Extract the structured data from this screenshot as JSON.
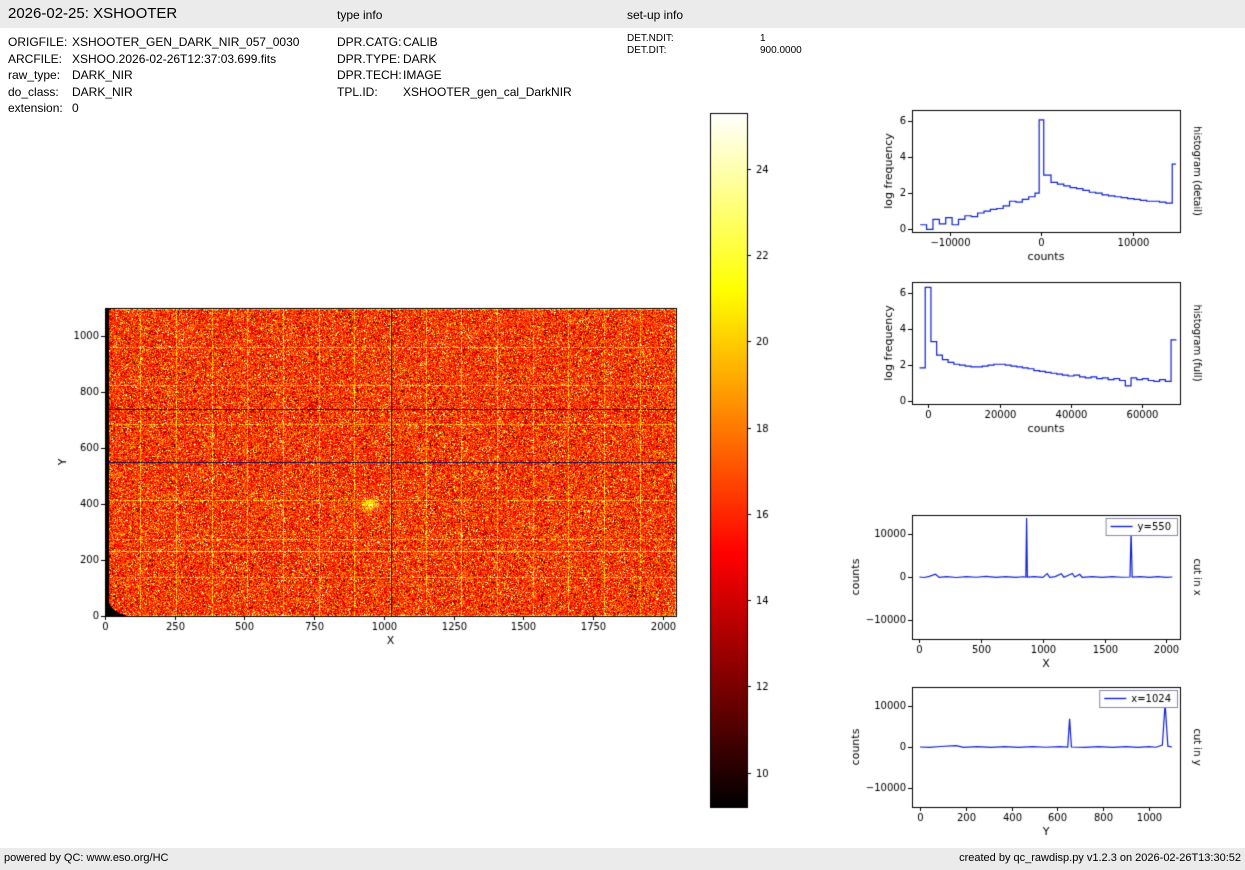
{
  "header": {
    "title": "2026-02-25: XSHOOTER",
    "type_info_label": "type info",
    "setup_info_label": "set-up info",
    "file_info": [
      {
        "label": "ORIGFILE:",
        "value": "XSHOOTER_GEN_DARK_NIR_057_0030"
      },
      {
        "label": "ARCFILE:",
        "value": "XSHOO.2026-02-26T12:37:03.699.fits"
      },
      {
        "label": "raw_type:",
        "value": "DARK_NIR"
      },
      {
        "label": "do_class:",
        "value": "DARK_NIR"
      },
      {
        "label": "extension:",
        "value": "0"
      }
    ],
    "type_info": [
      {
        "label": "DPR.CATG:",
        "value": "CALIB"
      },
      {
        "label": "DPR.TYPE:",
        "value": "DARK"
      },
      {
        "label": "DPR.TECH:",
        "value": "IMAGE"
      },
      {
        "label": "TPL.ID:",
        "value": "XSHOOTER_gen_cal_DarkNIR"
      }
    ],
    "setup_info": [
      {
        "label": "DET.NDIT:",
        "value": "1"
      },
      {
        "label": "DET.DIT:",
        "value": "900.0000"
      }
    ]
  },
  "footer": {
    "left": "powered by QC: www.eso.org/HC",
    "right": "created by qc_rawdisp.py v1.2.3 on 2026-02-26T13:30:52"
  },
  "chart_data": [
    {
      "id": "raw_image",
      "type": "heatmap",
      "description": "Raw NIR dark frame displayed with hot colormap: orange/red noise, scattered bright and dark speckles, faint bright grid lines, black left edge and rounded dark corners, dark crosshair cut lines at x=1024 and y=550",
      "xlabel": "X",
      "ylabel": "Y",
      "xlim": [
        0,
        2048
      ],
      "ylim": [
        0,
        1100
      ],
      "xticks": [
        0,
        250,
        500,
        750,
        1000,
        1250,
        1500,
        1750,
        2000
      ],
      "yticks": [
        0,
        200,
        400,
        600,
        800,
        1000
      ],
      "colormap": "hot",
      "value_range": [
        9.2,
        25.3
      ],
      "colorbar_ticks": [
        10,
        12,
        14,
        16,
        18,
        20,
        22,
        24
      ],
      "crosshair": {
        "x": 1024,
        "y": 550
      }
    },
    {
      "id": "histogram_detail",
      "type": "line",
      "step": true,
      "color": "#1122cc",
      "xlabel": "counts",
      "ylabel": "log frequency",
      "right_label": "histogram (detail)",
      "xlim": [
        -14200,
        15200
      ],
      "ylim": [
        -0.15,
        6.6
      ],
      "xticks": [
        -10000,
        0,
        10000
      ],
      "yticks": [
        0,
        2,
        4,
        6
      ],
      "points": [
        [
          -13300,
          0.25
        ],
        [
          -12600,
          0
        ],
        [
          -11900,
          0.55
        ],
        [
          -11200,
          0.3
        ],
        [
          -10500,
          0.65
        ],
        [
          -9800,
          0.25
        ],
        [
          -9100,
          0.55
        ],
        [
          -8400,
          0.75
        ],
        [
          -7700,
          0.7
        ],
        [
          -7000,
          0.9
        ],
        [
          -6300,
          1.0
        ],
        [
          -5600,
          1.1
        ],
        [
          -4900,
          1.15
        ],
        [
          -4200,
          1.3
        ],
        [
          -3500,
          1.55
        ],
        [
          -2800,
          1.5
        ],
        [
          -2100,
          1.65
        ],
        [
          -1400,
          1.8
        ],
        [
          -700,
          2.0
        ],
        [
          -250,
          6.05
        ],
        [
          250,
          3.0
        ],
        [
          1050,
          2.6
        ],
        [
          1750,
          2.5
        ],
        [
          2450,
          2.4
        ],
        [
          3150,
          2.3
        ],
        [
          3850,
          2.25
        ],
        [
          4550,
          2.15
        ],
        [
          5250,
          2.05
        ],
        [
          5950,
          2.0
        ],
        [
          6650,
          1.9
        ],
        [
          7350,
          1.85
        ],
        [
          8050,
          1.8
        ],
        [
          8750,
          1.75
        ],
        [
          9450,
          1.7
        ],
        [
          10150,
          1.65
        ],
        [
          10850,
          1.6
        ],
        [
          11550,
          1.55
        ],
        [
          12250,
          1.55
        ],
        [
          12950,
          1.5
        ],
        [
          13650,
          1.45
        ],
        [
          14350,
          3.6
        ],
        [
          14750,
          3.6
        ]
      ]
    },
    {
      "id": "histogram_full",
      "type": "line",
      "step": true,
      "color": "#1122cc",
      "xlabel": "counts",
      "ylabel": "log frequency",
      "right_label": "histogram (full)",
      "xlim": [
        -4500,
        70500
      ],
      "ylim": [
        -0.15,
        6.6
      ],
      "xticks": [
        0,
        20000,
        40000,
        60000
      ],
      "yticks": [
        0,
        2,
        4,
        6
      ],
      "points": [
        [
          -2400,
          1.85
        ],
        [
          -800,
          6.3
        ],
        [
          800,
          3.3
        ],
        [
          2400,
          2.55
        ],
        [
          4000,
          2.3
        ],
        [
          5600,
          2.15
        ],
        [
          7200,
          2.05
        ],
        [
          8800,
          2.0
        ],
        [
          10400,
          1.95
        ],
        [
          12000,
          1.9
        ],
        [
          13600,
          1.9
        ],
        [
          15200,
          1.95
        ],
        [
          16800,
          2.0
        ],
        [
          18400,
          2.05
        ],
        [
          20000,
          2.05
        ],
        [
          21600,
          2.0
        ],
        [
          23200,
          1.95
        ],
        [
          24800,
          1.9
        ],
        [
          26400,
          1.85
        ],
        [
          28000,
          1.8
        ],
        [
          29600,
          1.7
        ],
        [
          31200,
          1.65
        ],
        [
          32800,
          1.6
        ],
        [
          34400,
          1.55
        ],
        [
          36000,
          1.5
        ],
        [
          37600,
          1.45
        ],
        [
          39200,
          1.4
        ],
        [
          40800,
          1.45
        ],
        [
          42400,
          1.35
        ],
        [
          44000,
          1.3
        ],
        [
          45600,
          1.35
        ],
        [
          47200,
          1.25
        ],
        [
          48800,
          1.3
        ],
        [
          50400,
          1.2
        ],
        [
          52000,
          1.25
        ],
        [
          53600,
          1.15
        ],
        [
          55200,
          0.85
        ],
        [
          56800,
          1.3
        ],
        [
          58400,
          1.2
        ],
        [
          60000,
          1.25
        ],
        [
          61600,
          1.15
        ],
        [
          63200,
          1.1
        ],
        [
          64800,
          1.2
        ],
        [
          66400,
          1.1
        ],
        [
          68000,
          3.4
        ],
        [
          69500,
          3.4
        ]
      ]
    },
    {
      "id": "cut_in_x",
      "type": "line",
      "step": false,
      "color": "#1122cc",
      "legend": "y=550",
      "xlabel": "X",
      "ylabel": "counts",
      "right_label": "cut in x",
      "xlim": [
        -60,
        2110
      ],
      "ylim": [
        -14500,
        14500
      ],
      "xticks": [
        0,
        500,
        1000,
        1500,
        2000
      ],
      "yticks": [
        -10000,
        0,
        10000
      ],
      "points": [
        [
          0,
          0
        ],
        [
          40,
          -120
        ],
        [
          80,
          150
        ],
        [
          130,
          650
        ],
        [
          160,
          -80
        ],
        [
          220,
          100
        ],
        [
          300,
          -120
        ],
        [
          380,
          90
        ],
        [
          460,
          -60
        ],
        [
          540,
          130
        ],
        [
          620,
          -90
        ],
        [
          700,
          110
        ],
        [
          780,
          -70
        ],
        [
          840,
          60
        ],
        [
          862,
          0
        ],
        [
          868,
          13800
        ],
        [
          874,
          0
        ],
        [
          930,
          100
        ],
        [
          1000,
          -80
        ],
        [
          1035,
          800
        ],
        [
          1055,
          -60
        ],
        [
          1100,
          90
        ],
        [
          1148,
          760
        ],
        [
          1170,
          -50
        ],
        [
          1238,
          840
        ],
        [
          1258,
          0
        ],
        [
          1298,
          640
        ],
        [
          1318,
          -60
        ],
        [
          1400,
          110
        ],
        [
          1480,
          -90
        ],
        [
          1560,
          100
        ],
        [
          1640,
          -60
        ],
        [
          1705,
          0
        ],
        [
          1714,
          10600
        ],
        [
          1723,
          0
        ],
        [
          1790,
          100
        ],
        [
          1860,
          -110
        ],
        [
          1930,
          90
        ],
        [
          2000,
          -70
        ],
        [
          2048,
          0
        ]
      ]
    },
    {
      "id": "cut_in_y",
      "type": "line",
      "step": false,
      "color": "#1122cc",
      "legend": "x=1024",
      "xlabel": "Y",
      "ylabel": "counts",
      "right_label": "cut in y",
      "xlim": [
        -35,
        1135
      ],
      "ylim": [
        -14500,
        14500
      ],
      "xticks": [
        0,
        200,
        400,
        600,
        800,
        1000
      ],
      "yticks": [
        -10000,
        0,
        10000
      ],
      "points": [
        [
          0,
          0
        ],
        [
          40,
          -110
        ],
        [
          90,
          120
        ],
        [
          158,
          340
        ],
        [
          190,
          -90
        ],
        [
          250,
          100
        ],
        [
          310,
          -70
        ],
        [
          370,
          110
        ],
        [
          430,
          -90
        ],
        [
          490,
          100
        ],
        [
          550,
          -60
        ],
        [
          610,
          90
        ],
        [
          645,
          0
        ],
        [
          653,
          6800
        ],
        [
          661,
          0
        ],
        [
          720,
          -90
        ],
        [
          780,
          100
        ],
        [
          840,
          -110
        ],
        [
          900,
          90
        ],
        [
          950,
          -70
        ],
        [
          1000,
          110
        ],
        [
          1030,
          -60
        ],
        [
          1058,
          480
        ],
        [
          1070,
          10500
        ],
        [
          1082,
          200
        ],
        [
          1100,
          0
        ]
      ]
    }
  ]
}
